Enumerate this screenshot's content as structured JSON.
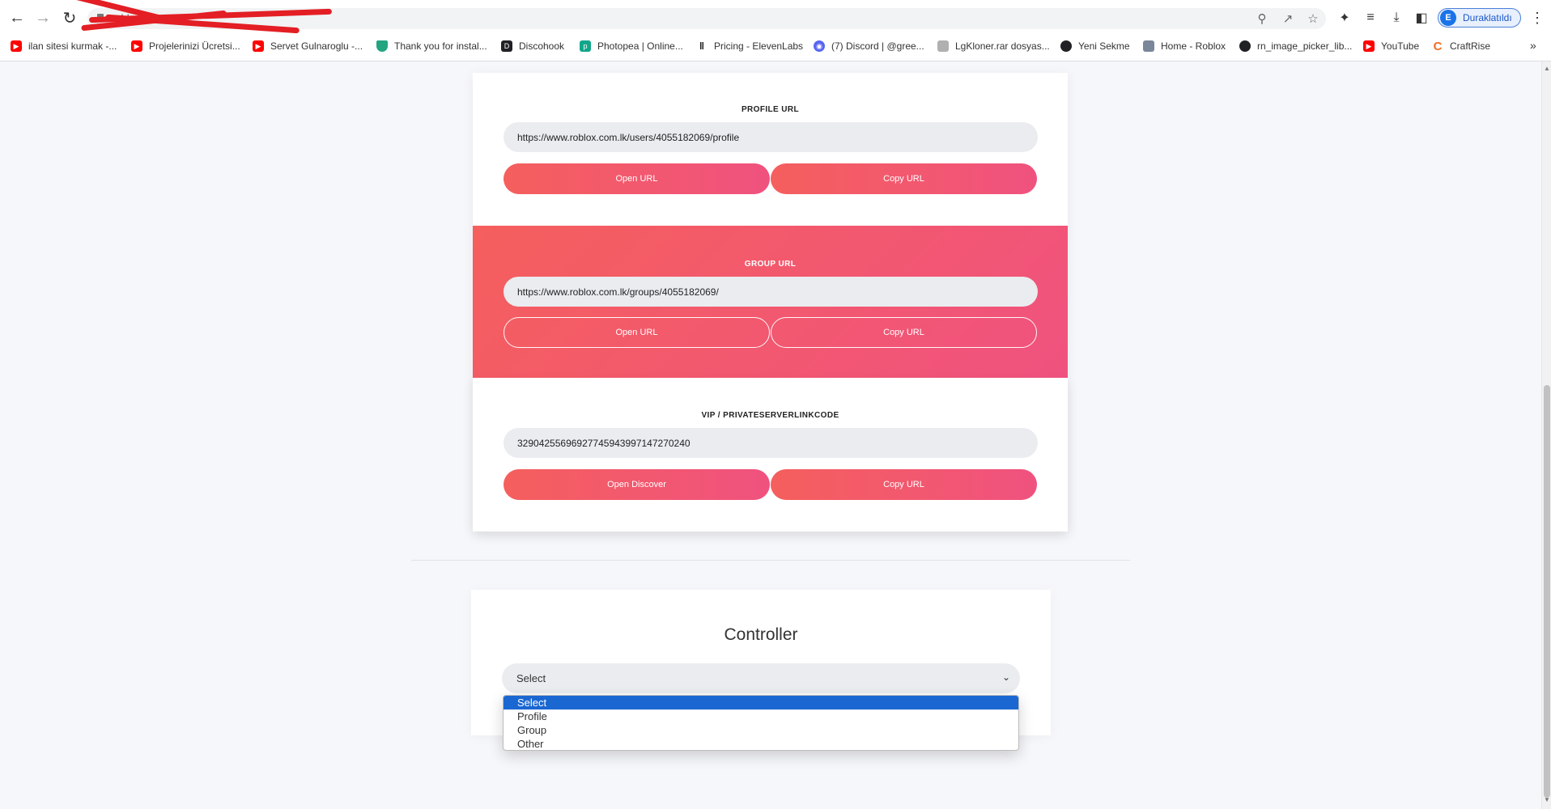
{
  "browser": {
    "url": "robl",
    "profile_initial": "E",
    "profile_name": "Duraklatıldı",
    "bookmarks": [
      {
        "label": "ilan sitesi kurmak -...",
        "icon": "youtube-icon"
      },
      {
        "label": "Projelerinizi Ücretsi...",
        "icon": "youtube-icon"
      },
      {
        "label": "Servet Gulnaroglu -...",
        "icon": "youtube-icon"
      },
      {
        "label": "Thank you for instal...",
        "icon": "shield-icon"
      },
      {
        "label": "Discohook",
        "icon": "discohook-icon"
      },
      {
        "label": "Photopea | Online...",
        "icon": "photopea-icon"
      },
      {
        "label": "Pricing - ElevenLabs",
        "icon": "elevenlabs-icon"
      },
      {
        "label": "(7) Discord | @gree...",
        "icon": "discord-icon"
      },
      {
        "label": "LgKloner.rar dosyas...",
        "icon": "file-icon"
      },
      {
        "label": "Yeni Sekme",
        "icon": "globe-icon"
      },
      {
        "label": "Home - Roblox",
        "icon": "roblox-icon"
      },
      {
        "label": "rn_image_picker_lib...",
        "icon": "globe-icon"
      },
      {
        "label": "YouTube",
        "icon": "youtube-icon"
      },
      {
        "label": "CraftRise",
        "icon": "craftrise-icon"
      }
    ],
    "colors": {
      "accent": "#1a73e8",
      "redaction": "#e31e24"
    }
  },
  "profile_section": {
    "label": "PROFILE URL",
    "url": "https://www.roblox.com.lk/users/4055182069/profile",
    "open_label": "Open URL",
    "copy_label": "Copy URL"
  },
  "group_section": {
    "label": "GROUP URL",
    "url": "https://www.roblox.com.lk/groups/4055182069/",
    "open_label": "Open URL",
    "copy_label": "Copy URL"
  },
  "vip_section": {
    "label": "VIP / PRIVATESERVERLINKCODE",
    "code": "32904255696927745943997147270240",
    "open_label": "Open Discover",
    "copy_label": "Copy URL"
  },
  "controller": {
    "title": "Controller",
    "selected": "Select",
    "options": [
      "Select",
      "Profile",
      "Group",
      "Other"
    ]
  },
  "theme": {
    "gradient_start": "#f55f5d",
    "gradient_end": "#f0527f",
    "highlight": "#1a67d2"
  }
}
